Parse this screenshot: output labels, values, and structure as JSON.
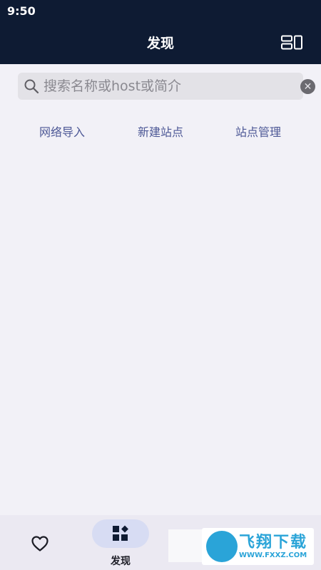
{
  "status_bar": {
    "time": "9:50"
  },
  "header": {
    "title": "发现",
    "layout_icon": "layout-toggle-icon"
  },
  "search": {
    "placeholder": "搜索名称或host或简介",
    "value": ""
  },
  "actions": [
    {
      "label": "网络导入"
    },
    {
      "label": "新建站点"
    },
    {
      "label": "站点管理"
    }
  ],
  "bottom_nav": {
    "items": [
      {
        "icon": "heart-icon",
        "label": ""
      },
      {
        "icon": "apps-icon",
        "label": "发现",
        "active": true
      }
    ]
  },
  "watermark": {
    "text": "飞翔下载",
    "url": "WWW.FXXZ.COM"
  },
  "colors": {
    "header_bg": "#0e1b33",
    "page_bg": "#f2f1f7",
    "action_text": "#4d5896",
    "nav_active_pill": "#d7dcf3",
    "watermark": "#2aa4d8"
  }
}
